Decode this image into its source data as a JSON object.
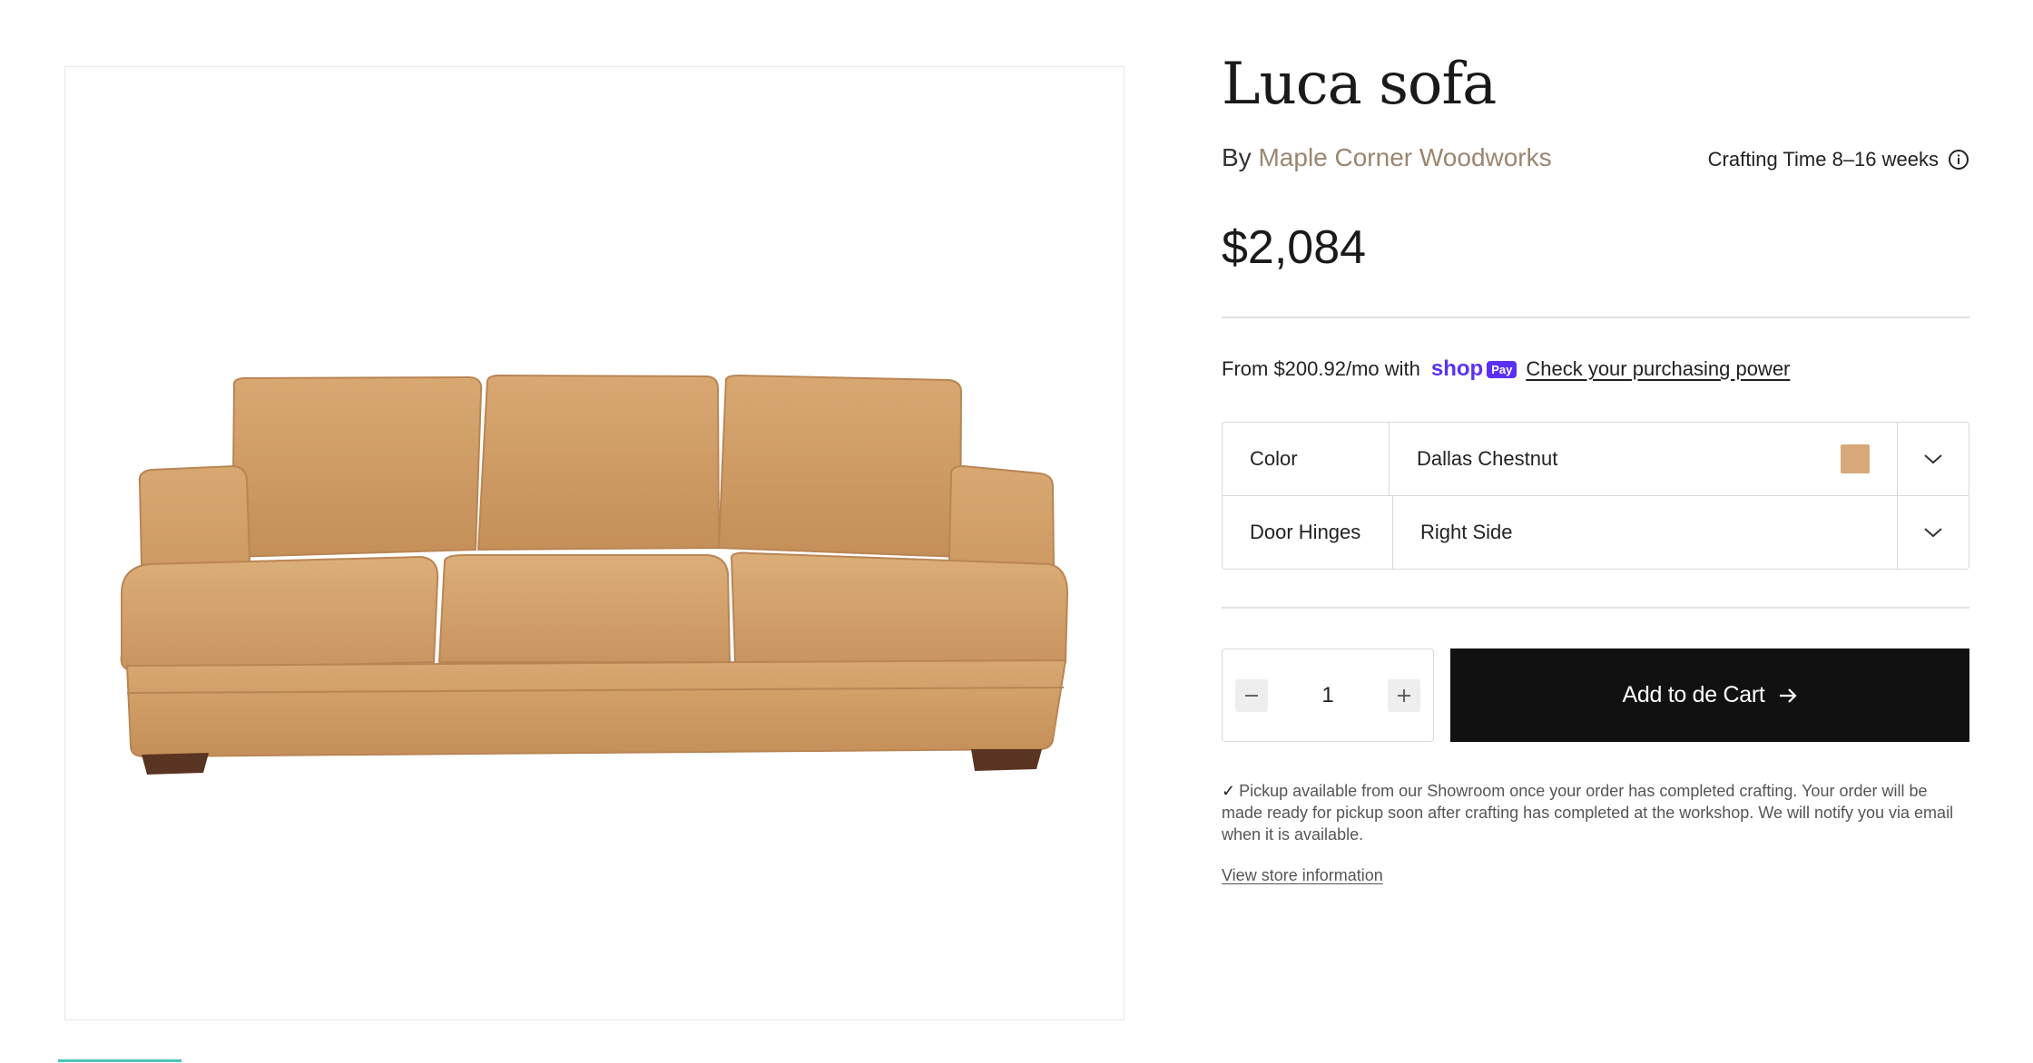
{
  "product": {
    "title": "Luca sofa",
    "by_prefix": "By",
    "vendor": "Maple Corner Woodworks",
    "crafting_time": "Crafting Time 8–16 weeks",
    "price": "$2,084"
  },
  "installments": {
    "prefix": "From $200.92/mo with",
    "shop_word": "shop",
    "pay_badge": "Pay",
    "link": "Check your purchasing power"
  },
  "options": [
    {
      "label": "Color",
      "value": "Dallas Chestnut",
      "swatch_color": "#d7a878"
    },
    {
      "label": "Door Hinges",
      "value": "Right Side"
    }
  ],
  "cart": {
    "quantity": "1",
    "add_label": "Add to de Cart"
  },
  "pickup": {
    "check": "✓",
    "text": "Pickup available from our Showroom once your order has completed crafting. Your order will be made ready for pickup soon after crafting has completed at the workshop. We will notify you via email when it is available.",
    "store_link": "View store information"
  },
  "icons": {
    "info": "info-circle-icon",
    "chevron": "chevron-down-icon",
    "minus": "minus-icon",
    "plus": "plus-icon",
    "arrow": "arrow-right-icon"
  },
  "colors": {
    "vendor": "#9a8670",
    "shop_pay": "#5a31f4",
    "button": "#111111",
    "sofa": "#d4a06c",
    "indicator": "#4fc3b2"
  }
}
